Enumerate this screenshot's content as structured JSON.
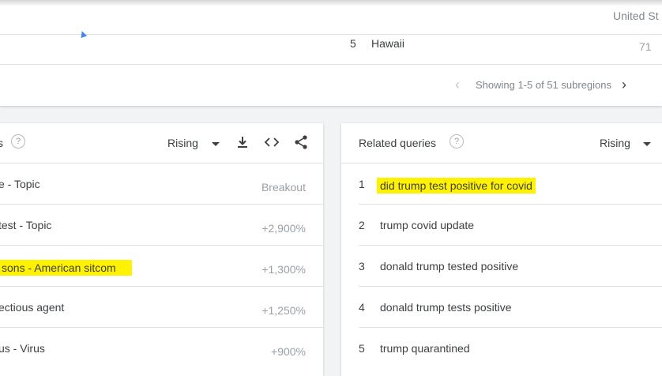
{
  "region_panel": {
    "header_label": "United St",
    "top_row": {
      "rank": "5",
      "name": "Hawaii",
      "value": "71"
    },
    "pager_text": "Showing 1-5 of 51 subregions"
  },
  "related_topics": {
    "title": "s",
    "filter_label": "Rising",
    "rows": [
      {
        "label": "e - Topic",
        "value": "Breakout"
      },
      {
        "label": "test - Topic",
        "value": "+2,900%"
      },
      {
        "label": "sons - American sitcom",
        "value": "+1,300%"
      },
      {
        "label": "ectious agent",
        "value": "+1,250%"
      },
      {
        "label": "us - Virus",
        "value": "+900%"
      }
    ]
  },
  "related_queries": {
    "title": "Related queries",
    "filter_label": "Rising",
    "rows": [
      {
        "rank": "1",
        "label": "did trump test positive for covid"
      },
      {
        "rank": "2",
        "label": "trump covid update"
      },
      {
        "rank": "3",
        "label": "donald trump tested positive"
      },
      {
        "rank": "4",
        "label": "donald trump tests positive"
      },
      {
        "rank": "5",
        "label": "trump quarantined"
      }
    ]
  },
  "colors": {
    "highlight": "#fff200",
    "map_marker": "#4285f4"
  },
  "icons": [
    "help-icon",
    "download-icon",
    "embed-icon",
    "share-icon",
    "chevron-left-icon",
    "chevron-right-icon",
    "caret-down-icon"
  ]
}
